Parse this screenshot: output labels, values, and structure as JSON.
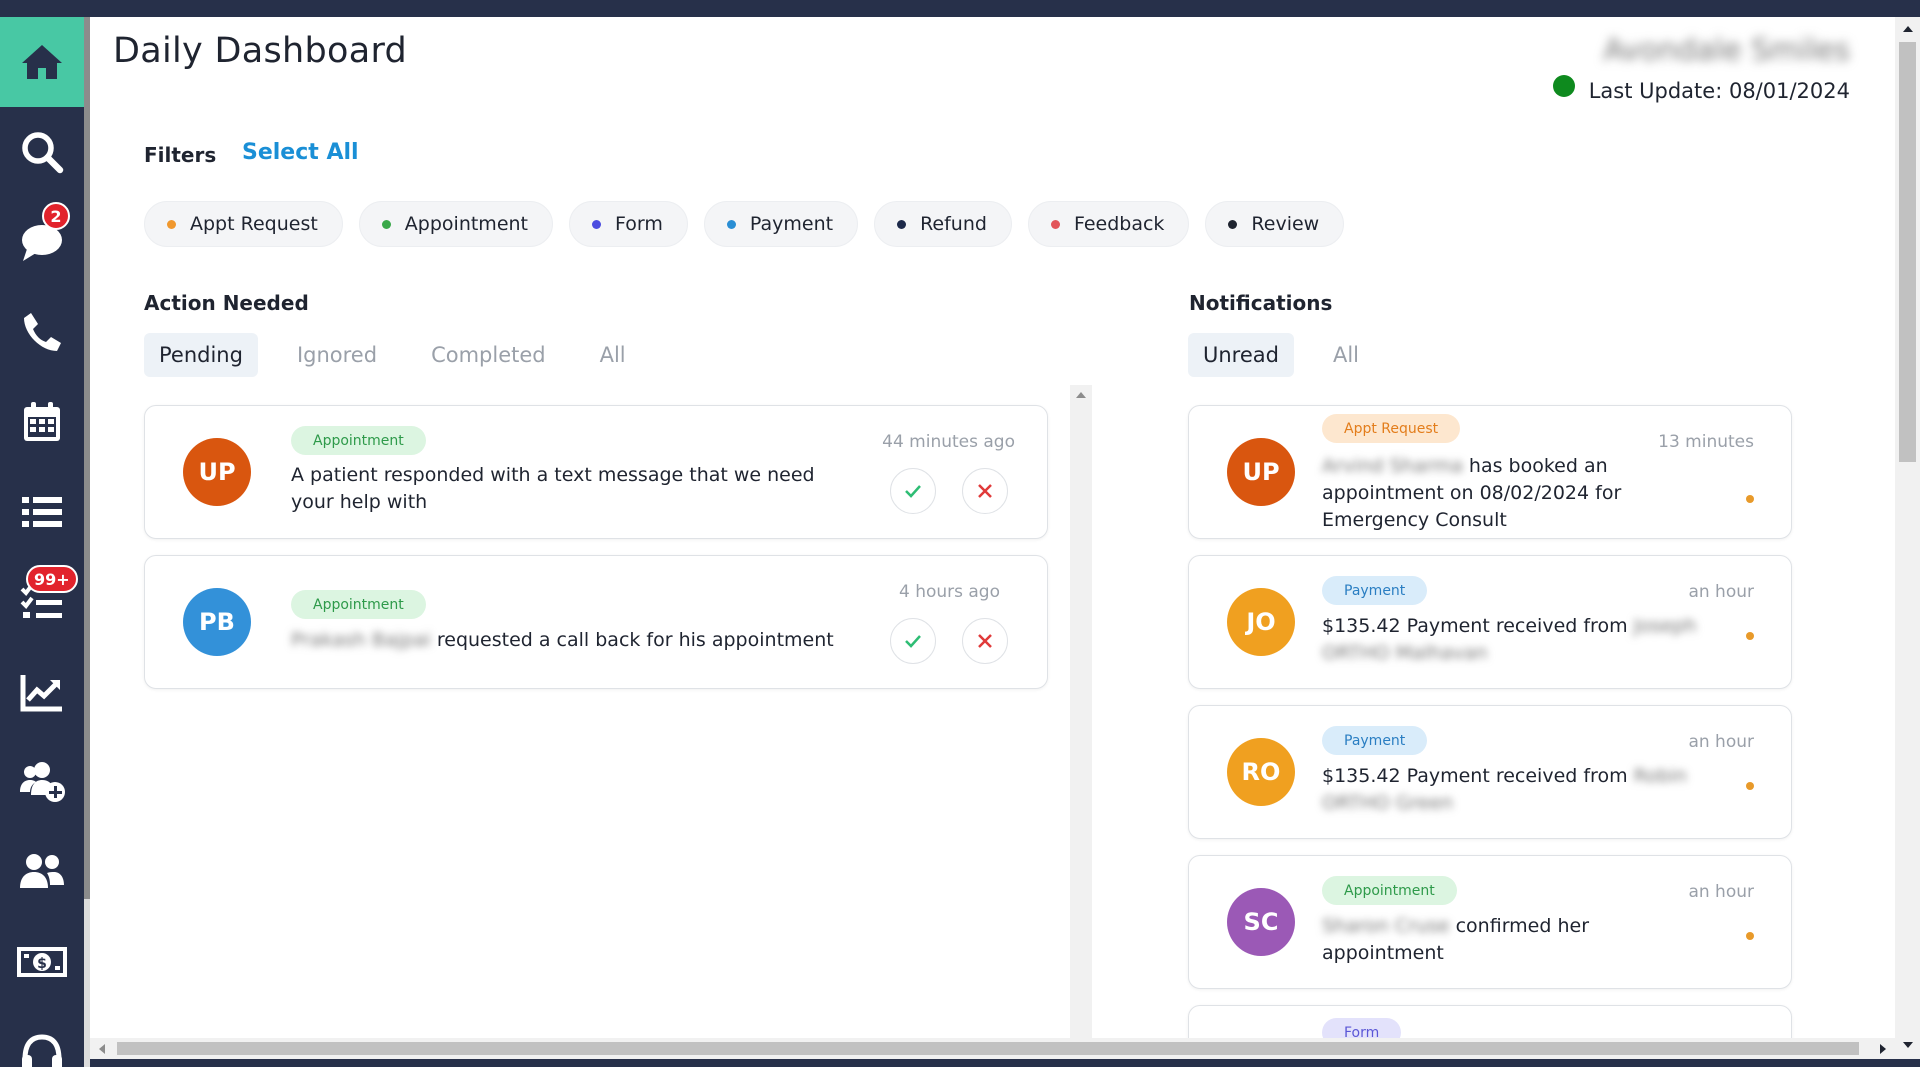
{
  "sidebar": {
    "items": [
      {
        "name": "home",
        "icon": "home-icon",
        "active": true
      },
      {
        "name": "search",
        "icon": "search-icon"
      },
      {
        "name": "messages",
        "icon": "chat-bubble-icon",
        "badge": "2"
      },
      {
        "name": "calls",
        "icon": "phone-icon"
      },
      {
        "name": "calendar",
        "icon": "calendar-icon"
      },
      {
        "name": "list",
        "icon": "list-icon"
      },
      {
        "name": "tasks",
        "icon": "checklist-icon",
        "badge": "99+"
      },
      {
        "name": "analytics",
        "icon": "chart-line-icon"
      },
      {
        "name": "add-patient",
        "icon": "user-group-plus-icon"
      },
      {
        "name": "patients",
        "icon": "users-icon"
      },
      {
        "name": "billing",
        "icon": "money-bill-icon"
      },
      {
        "name": "support",
        "icon": "headset-icon"
      }
    ]
  },
  "header": {
    "title": "Daily Dashboard",
    "practice_name": "Avondale Smiles",
    "last_update": "Last Update: 08/01/2024",
    "status_color": "#0e8a1e"
  },
  "filters": {
    "label": "Filters",
    "select_all": "Select All",
    "chips": [
      {
        "label": "Appt Request",
        "color": "#f0982e"
      },
      {
        "label": "Appointment",
        "color": "#3aa84a"
      },
      {
        "label": "Form",
        "color": "#4c4de0"
      },
      {
        "label": "Payment",
        "color": "#2a8ed4"
      },
      {
        "label": "Refund",
        "color": "#1d2a4a"
      },
      {
        "label": "Feedback",
        "color": "#e2555a"
      },
      {
        "label": "Review",
        "color": "#1f2430"
      }
    ]
  },
  "action_needed": {
    "title": "Action Needed",
    "tabs": [
      "Pending",
      "Ignored",
      "Completed",
      "All"
    ],
    "active_tab": "Pending",
    "cards": [
      {
        "initials": "UP",
        "avatar_color": "#d9560f",
        "tag": "Appointment",
        "text": "A patient responded with a text message that we need your help with",
        "time": "44 minutes ago"
      },
      {
        "initials": "PB",
        "avatar_color": "#3391d9",
        "tag": "Appointment",
        "name": "Prakash Bajpai",
        "text": "requested a call back for his appointment",
        "time": "4 hours ago"
      }
    ]
  },
  "notifications": {
    "title": "Notifications",
    "tabs": [
      "Unread",
      "All"
    ],
    "active_tab": "Unread",
    "cards": [
      {
        "initials": "UP",
        "avatar_color": "#d9560f",
        "tag": "Appt Request",
        "name": "Arvind Sharma",
        "text_a": "has booked an",
        "text_b": "appointment on 08/02/2024 for",
        "text_c": "Emergency Consult",
        "time": "13 minutes"
      },
      {
        "initials": "JO",
        "avatar_color": "#f0a020",
        "tag": "Payment",
        "text": "$135.42 Payment received from",
        "name_a": "Joseph",
        "name_b": "ORTHO Malhavan",
        "time": "an hour"
      },
      {
        "initials": "RO",
        "avatar_color": "#f0a020",
        "tag": "Payment",
        "text": "$135.42 Payment received from",
        "name_a": "Robin",
        "name_b": "ORTHO Green",
        "time": "an hour"
      },
      {
        "initials": "SC",
        "avatar_color": "#9b59b6",
        "tag": "Appointment",
        "name": "Sharon Cruse",
        "text_a": "confirmed her",
        "text_b": "appointment",
        "time": "an hour"
      },
      {
        "tag": "Form"
      }
    ]
  }
}
